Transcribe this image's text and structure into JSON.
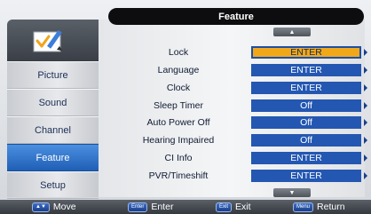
{
  "header": {
    "title": "Feature"
  },
  "sidebar": {
    "icon": "feature-settings-icon",
    "items": [
      {
        "label": "Picture",
        "active": false
      },
      {
        "label": "Sound",
        "active": false
      },
      {
        "label": "Channel",
        "active": false
      },
      {
        "label": "Feature",
        "active": true
      },
      {
        "label": "Setup",
        "active": false
      }
    ]
  },
  "menu": {
    "rows": [
      {
        "label": "Lock",
        "value": "ENTER",
        "selected": true
      },
      {
        "label": "Language",
        "value": "ENTER",
        "selected": false
      },
      {
        "label": "Clock",
        "value": "ENTER",
        "selected": false
      },
      {
        "label": "Sleep Timer",
        "value": "Off",
        "selected": false
      },
      {
        "label": "Auto Power Off",
        "value": "Off",
        "selected": false
      },
      {
        "label": "Hearing Impaired",
        "value": "Off",
        "selected": false
      },
      {
        "label": "CI Info",
        "value": "ENTER",
        "selected": false
      },
      {
        "label": "PVR/Timeshift",
        "value": "ENTER",
        "selected": false
      }
    ]
  },
  "footer": {
    "hints": [
      {
        "key": "▲▼",
        "label": "Move"
      },
      {
        "key": "Enter",
        "label": "Enter"
      },
      {
        "key": "Exit",
        "label": "Exit"
      },
      {
        "key": "Menu",
        "label": "Return"
      }
    ]
  },
  "colors": {
    "selection": "#f0a81a",
    "value_bg": "#2357b2",
    "sidebar_active": "#1f5fb6",
    "header_bg": "#0d0d0f"
  }
}
